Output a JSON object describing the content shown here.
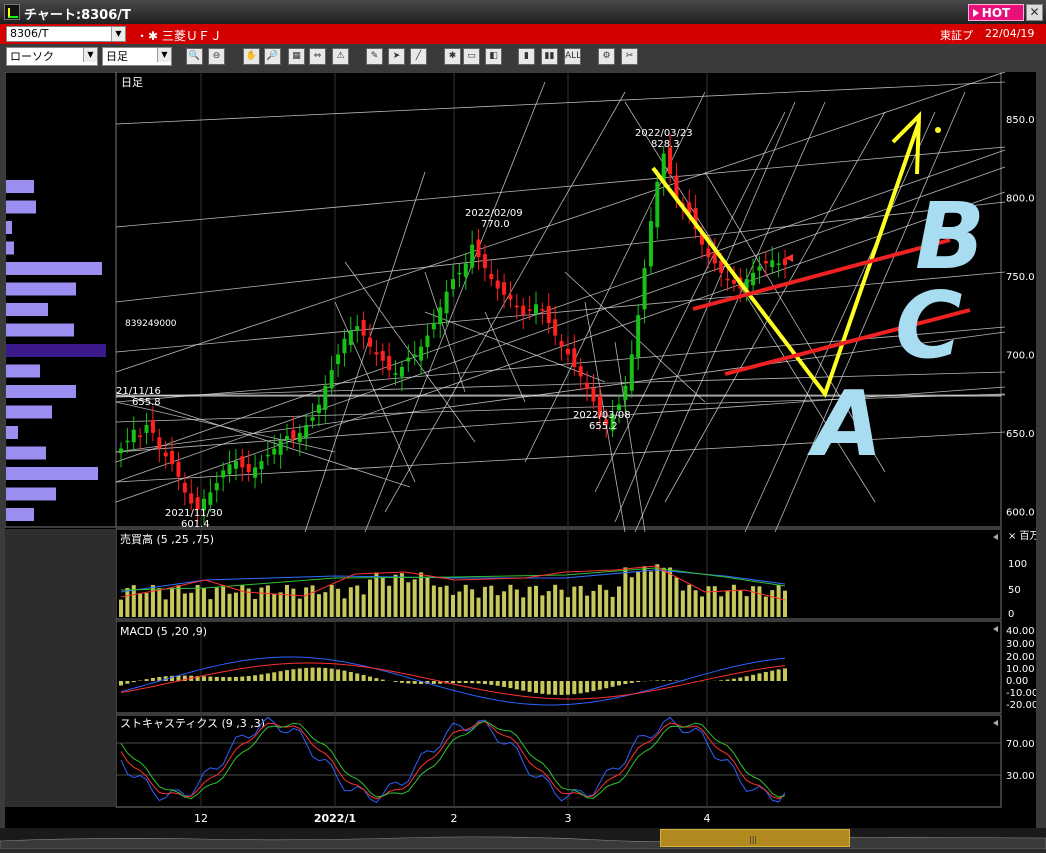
{
  "window": {
    "title": "チャート:8306/T",
    "hot_label": "HOT",
    "close_label": "✕"
  },
  "symbol_bar": {
    "symbol": "8306/T",
    "company": "・✱ 三菱ＵＦＪ",
    "exchange": "東証プ",
    "date": "22/04/19"
  },
  "toolbar": {
    "chart_type": "ローソク",
    "period": "日足",
    "buttons": [
      "zoom",
      "zoom-out",
      "hand",
      "search",
      "table",
      "arrows",
      "warning",
      "pencil",
      "cursor",
      "line-draw",
      "star",
      "rect",
      "color",
      "bars",
      "bars2",
      "all",
      "settings",
      "tools",
      "draw",
      "palette",
      "log",
      "window"
    ]
  },
  "main_chart": {
    "label": "日足",
    "y_labels": [
      "850.0",
      "800.0",
      "750.0",
      "700.0",
      "650.0",
      "600.0"
    ],
    "volume_marker": "839249000",
    "annotations": [
      {
        "date": "2022/03/23",
        "value": "828.3"
      },
      {
        "date": "2022/02/09",
        "value": "770.0"
      },
      {
        "date": "2022/03/08",
        "value": "655.2"
      },
      {
        "date": "21/11/16",
        "value": "655.8"
      },
      {
        "date": "2021/11/30",
        "value": "601.4"
      }
    ],
    "drawn_letters": [
      "A",
      "B",
      "C"
    ]
  },
  "volume_panel": {
    "label": "売買高 (5 ,25 ,75)",
    "unit": "× 百万",
    "y_labels": [
      "100",
      "50",
      "0"
    ]
  },
  "macd_panel": {
    "label": "MACD (5 ,20 ,9)",
    "y_labels": [
      "40.00",
      "30.00",
      "20.00",
      "10.00",
      "0.00",
      "-10.00",
      "-20.00"
    ]
  },
  "stoch_panel": {
    "label": "ストキャスティクス (9 ,3 ,3)",
    "y_labels": [
      "70.00",
      "30.00"
    ]
  },
  "x_labels": [
    "12",
    "2022/1",
    "2",
    "3",
    "4"
  ],
  "colors": {
    "bull": "#18c018",
    "bear": "#ff2020",
    "grid": "#ffffff",
    "volume_bar": "#c8c85a",
    "profile_bar": "#9a8ff0",
    "profile_highlight": "#3c1a8c",
    "yellow": "#ffff22",
    "red_line": "#ee2222",
    "letters": "#a8dcf0"
  },
  "chart_data": {
    "type": "candlestick",
    "x_range": [
      "2021/11",
      "2022/04/19"
    ],
    "y_range": [
      590,
      880
    ],
    "series": [
      {
        "name": "",
        "close": [
          640,
          645,
          652,
          648,
          655,
          650,
          640,
          635,
          630,
          622,
          612,
          605,
          601,
          608,
          612,
          618,
          626,
          630,
          632,
          628,
          625,
          628,
          632,
          636,
          640,
          645,
          648,
          646,
          650,
          655,
          660,
          668,
          680,
          690,
          700,
          710,
          715,
          718,
          712,
          705,
          700,
          696,
          690,
          688,
          692,
          698,
          700,
          705,
          712,
          720,
          730,
          740,
          748,
          752,
          758,
          770,
          762,
          755,
          748,
          742,
          738,
          735,
          730,
          725,
          728,
          732,
          728,
          720,
          712,
          705,
          700,
          692,
          686,
          678,
          670,
          660,
          655,
          662,
          668,
          680,
          700,
          725,
          755,
          785,
          810,
          828,
          815,
          800,
          795,
          790,
          780,
          770,
          762,
          758,
          752,
          748,
          745,
          742,
          748,
          752,
          756,
          758,
          760,
          758,
          757
        ]
      }
    ],
    "volume_ma": [
      5,
      25,
      75
    ],
    "macd_params": [
      5,
      20,
      9
    ],
    "stoch_params": [
      9,
      3,
      3
    ],
    "profile_bars": [
      28,
      30,
      6,
      8,
      96,
      70,
      42,
      68,
      100,
      34,
      70,
      46,
      12,
      40,
      92,
      50,
      28
    ]
  }
}
